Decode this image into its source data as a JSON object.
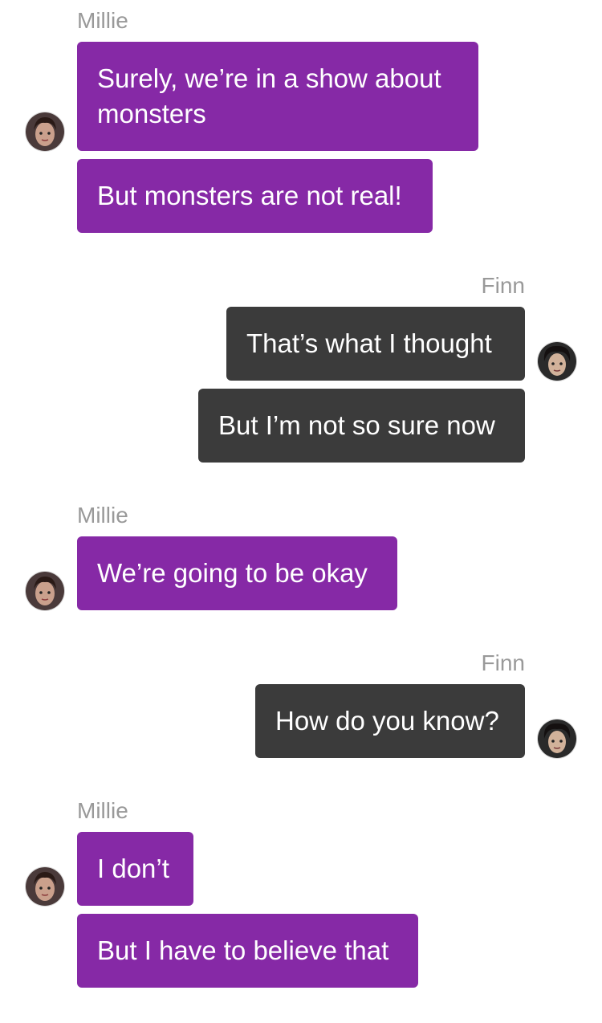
{
  "colors": {
    "millie_bubble": "#8629a6",
    "finn_bubble": "#3b3b3b",
    "name_text": "#999999",
    "bubble_text": "#ffffff"
  },
  "groups": [
    {
      "sender": "Millie",
      "side": "left",
      "avatar_icon": "millie-avatar",
      "messages": [
        "Surely, we’re in a show about\nmonsters",
        "But monsters are not real!"
      ]
    },
    {
      "sender": "Finn",
      "side": "right",
      "avatar_icon": "finn-avatar",
      "messages": [
        "That’s what I thought",
        "But I’m not so sure now"
      ]
    },
    {
      "sender": "Millie",
      "side": "left",
      "avatar_icon": "millie-avatar",
      "messages": [
        "We’re going to be okay"
      ]
    },
    {
      "sender": "Finn",
      "side": "right",
      "avatar_icon": "finn-avatar",
      "messages": [
        "How do you know?"
      ]
    },
    {
      "sender": "Millie",
      "side": "left",
      "avatar_icon": "millie-avatar",
      "messages": [
        "I don’t",
        "But I have to believe that"
      ]
    }
  ]
}
